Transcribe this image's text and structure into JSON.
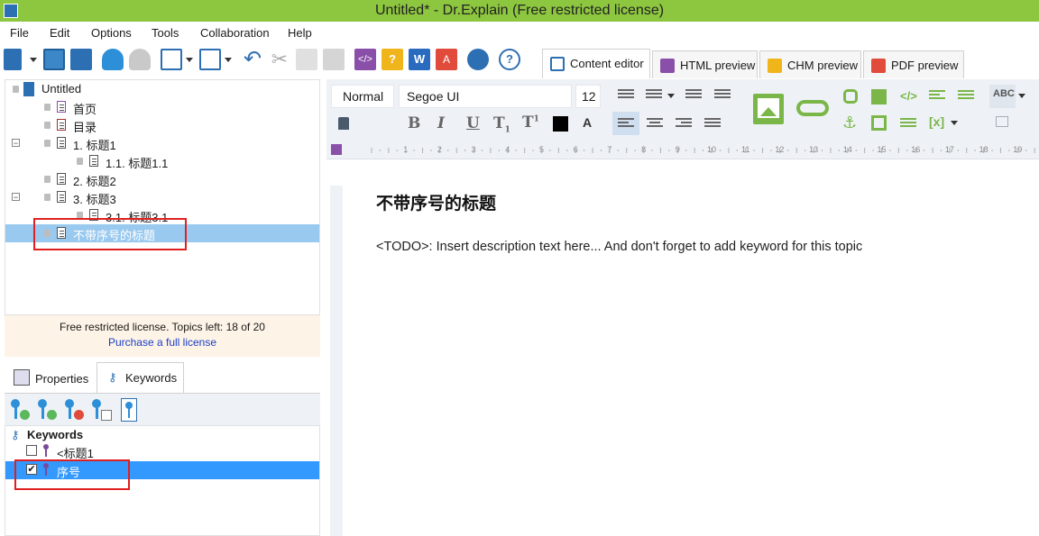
{
  "window": {
    "title": "Untitled* - Dr.Explain (Free restricted license)"
  },
  "menu": [
    "File",
    "Edit",
    "Options",
    "Tools",
    "Collaboration",
    "Help"
  ],
  "editor_tabs": [
    {
      "label": "Content editor",
      "icon": "edit-icon",
      "active": true
    },
    {
      "label": "HTML preview",
      "icon": "html-preview-icon",
      "active": false
    },
    {
      "label": "CHM preview",
      "icon": "chm-preview-icon",
      "active": false
    },
    {
      "label": "PDF preview",
      "icon": "pdf-preview-icon",
      "active": false
    }
  ],
  "tree": {
    "root": "Untitled",
    "items": [
      {
        "label": "首页",
        "icon": "home-page-icon"
      },
      {
        "label": "目录",
        "icon": "toc-page-icon"
      },
      {
        "label": "1. 标题1",
        "icon": "page-icon",
        "expanded": true
      },
      {
        "label": "1.1. 标题1.1",
        "icon": "page-icon"
      },
      {
        "label": "2. 标题2",
        "icon": "page-icon"
      },
      {
        "label": "3. 标题3",
        "icon": "page-icon",
        "expanded": true
      },
      {
        "label": "3.1. 标题3.1",
        "icon": "page-icon"
      },
      {
        "label": "不带序号的标题",
        "icon": "page-icon",
        "selected": true
      }
    ]
  },
  "license": {
    "text": "Free restricted license. Topics left: 18 of 20",
    "link": "Purchase a full license"
  },
  "bottom_tabs": [
    {
      "label": "Properties",
      "active": false
    },
    {
      "label": "Keywords",
      "active": true
    }
  ],
  "keywords": {
    "header": "Keywords",
    "items": [
      {
        "label": "<标题1",
        "checked": false
      },
      {
        "label": "序号",
        "checked": true,
        "selected": true
      }
    ]
  },
  "format": {
    "style": "Normal",
    "font": "Segoe UI",
    "size": "12"
  },
  "ruler_numbers": [
    "1",
    "2",
    "3",
    "4",
    "5",
    "6",
    "7",
    "8",
    "9",
    "10",
    "11",
    "12",
    "13",
    "14",
    "15",
    "16",
    "17",
    "18",
    "19"
  ],
  "document": {
    "title": "不带序号的标题",
    "body": "<TODO>: Insert description text here... And don't forget to add keyword for this topic"
  },
  "colors": {
    "titlebar": "#8dc63f",
    "selection": "#3399ff",
    "tree_selection": "#99c9ef",
    "accent_green": "#7ab648",
    "highlight_box": "#e02020"
  }
}
